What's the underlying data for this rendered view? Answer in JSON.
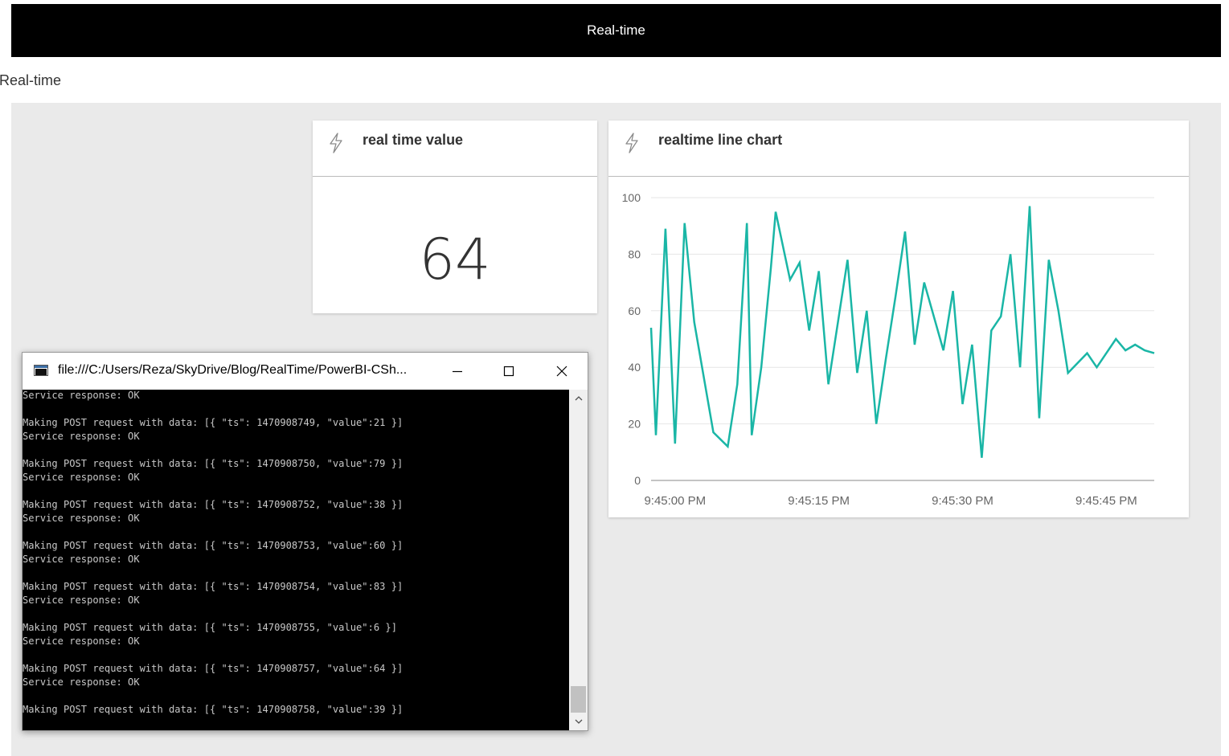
{
  "header": {
    "title": "Real-time"
  },
  "dashboard": {
    "title": "Real-time"
  },
  "tiles": {
    "card": {
      "title": "real time value",
      "value": "64",
      "icon": "lightning-bolt-icon"
    },
    "chart": {
      "title": "realtime line chart",
      "icon": "lightning-bolt-icon"
    }
  },
  "console": {
    "title": "file:///C:/Users/Reza/SkyDrive/Blog/RealTime/PowerBI-CSh...",
    "lines": [
      "Service response: OK",
      "",
      "Making POST request with data: [{ \"ts\": 1470908749, \"value\":21 }]",
      "Service response: OK",
      "",
      "Making POST request with data: [{ \"ts\": 1470908750, \"value\":79 }]",
      "Service response: OK",
      "",
      "Making POST request with data: [{ \"ts\": 1470908752, \"value\":38 }]",
      "Service response: OK",
      "",
      "Making POST request with data: [{ \"ts\": 1470908753, \"value\":60 }]",
      "Service response: OK",
      "",
      "Making POST request with data: [{ \"ts\": 1470908754, \"value\":83 }]",
      "Service response: OK",
      "",
      "Making POST request with data: [{ \"ts\": 1470908755, \"value\":6 }]",
      "Service response: OK",
      "",
      "Making POST request with data: [{ \"ts\": 1470908757, \"value\":64 }]",
      "Service response: OK",
      "",
      "Making POST request with data: [{ \"ts\": 1470908758, \"value\":39 }]"
    ]
  },
  "chart_data": {
    "type": "line",
    "title": "realtime line chart",
    "color": "#1ab6a6",
    "ylim": [
      0,
      100
    ],
    "yticks": [
      0,
      20,
      40,
      60,
      80,
      100
    ],
    "xlim": [
      -0.5,
      52
    ],
    "xticks": [
      {
        "x": 2,
        "label": "9:45:00 PM"
      },
      {
        "x": 17,
        "label": "9:45:15 PM"
      },
      {
        "x": 32,
        "label": "9:45:30 PM"
      },
      {
        "x": 47,
        "label": "9:45:45 PM"
      }
    ],
    "grid": true,
    "series": [
      {
        "x": [
          -0.5,
          0,
          1,
          2,
          3,
          4,
          6,
          7.5,
          8.5,
          9.5,
          10,
          11,
          12,
          12.5,
          14,
          15,
          16,
          17,
          18,
          19,
          20,
          21,
          22,
          23,
          24,
          25,
          26,
          27,
          28,
          30,
          31,
          32,
          33,
          34,
          35,
          36,
          37,
          38,
          39,
          40,
          41,
          42,
          43,
          45,
          46,
          47,
          48,
          49,
          50,
          51,
          52
        ],
        "y": [
          54,
          16,
          89,
          13,
          91,
          56,
          17,
          12,
          34,
          91,
          16,
          40,
          75,
          95,
          71,
          77,
          53,
          74,
          34,
          56,
          78,
          38,
          60,
          20,
          43,
          65,
          88,
          48,
          70,
          46,
          67,
          27,
          48,
          8,
          53,
          58,
          80,
          40,
          97,
          22,
          78,
          60,
          38,
          45,
          40,
          45,
          50,
          46,
          48,
          46,
          45
        ]
      }
    ]
  }
}
